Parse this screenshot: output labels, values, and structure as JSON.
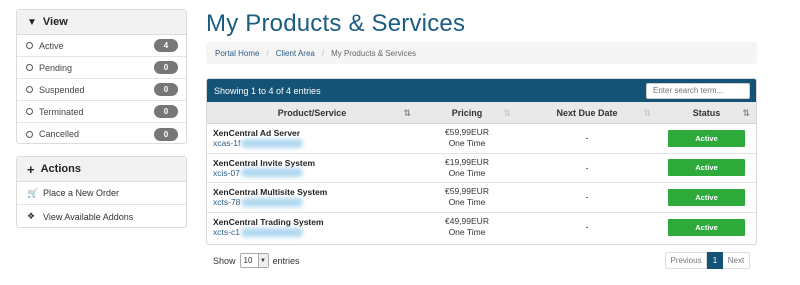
{
  "sidebar": {
    "view_title": "View",
    "view_items": [
      {
        "label": "Active",
        "count": "4"
      },
      {
        "label": "Pending",
        "count": "0"
      },
      {
        "label": "Suspended",
        "count": "0"
      },
      {
        "label": "Terminated",
        "count": "0"
      },
      {
        "label": "Cancelled",
        "count": "0"
      }
    ],
    "actions_title": "Actions",
    "actions": [
      {
        "label": "Place a New Order",
        "icon": "cart-icon"
      },
      {
        "label": "View Available Addons",
        "icon": "cubes-icon"
      }
    ]
  },
  "page": {
    "title": "My Products & Services",
    "breadcrumb": [
      "Portal Home",
      "Client Area",
      "My Products & Services"
    ]
  },
  "table": {
    "info": "Showing 1 to 4 of 4 entries",
    "search_placeholder": "Enter search term...",
    "columns": [
      "Product/Service",
      "Pricing",
      "Next Due Date",
      "Status"
    ],
    "rows": [
      {
        "name": "XenCentral Ad Server",
        "domain": "xcas-1f",
        "price": "€59,99EUR",
        "cycle": "One Time",
        "due": "-",
        "status": "Active"
      },
      {
        "name": "XenCentral Invite System",
        "domain": "xcis-07",
        "price": "€19,99EUR",
        "cycle": "One Time",
        "due": "-",
        "status": "Active"
      },
      {
        "name": "XenCentral Multisite System",
        "domain": "xcts-78",
        "price": "€59,99EUR",
        "cycle": "One Time",
        "due": "-",
        "status": "Active"
      },
      {
        "name": "XenCentral Trading System",
        "domain": "xcts-c1",
        "price": "€49,99EUR",
        "cycle": "One Time",
        "due": "-",
        "status": "Active"
      }
    ],
    "length_prefix": "Show",
    "length_value": "10",
    "length_suffix": "entries",
    "pager": {
      "prev": "Previous",
      "current": "1",
      "next": "Next"
    }
  },
  "colors": {
    "header_blue": "#145276",
    "title_blue": "#1b5c82",
    "status_green": "#2eaa3a"
  }
}
